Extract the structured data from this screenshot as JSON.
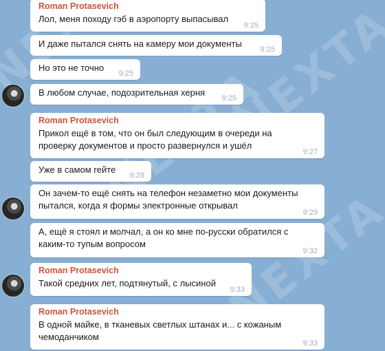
{
  "watermark": "NEXTA",
  "messages": [
    {
      "sender": "Roman Protasevich",
      "text": "Лол, меня походу гэб в аэропорту выпасывал",
      "time": "9:25"
    },
    {
      "text": "И даже пытался снять на камеру мои документы",
      "time": "9:25"
    },
    {
      "text": "Но это не точно",
      "time": "9:25"
    },
    {
      "text": "В любом случае, подозрительная херня",
      "time": "9:25"
    },
    {
      "sender": "Roman Protasevich",
      "text": "Прикол ещё в том, что он был следующим в очереди на проверку документов и просто развернулся и ушёл",
      "time": "9:27"
    },
    {
      "text": "Уже в самом гейте",
      "time": "9:28"
    },
    {
      "text": "Он зачем-то ещё снять на телефон незаметно мои документы пытался, когда я формы электронные открывал",
      "time": "9:29"
    },
    {
      "text": "А, ещё я стоял и молчал, а он ко мне по-русски обратился с каким-то тупым вопросом",
      "time": "9:32"
    },
    {
      "sender": "Roman Protasevich",
      "text": "Такой средних лет, подтянутый, с лысиной",
      "time": "9:33"
    },
    {
      "sender": "Roman Protasevich",
      "text": "В одной майке, в тканевых светлых штанах и... с кожаным чемоданчиком",
      "time": "9:33"
    }
  ]
}
